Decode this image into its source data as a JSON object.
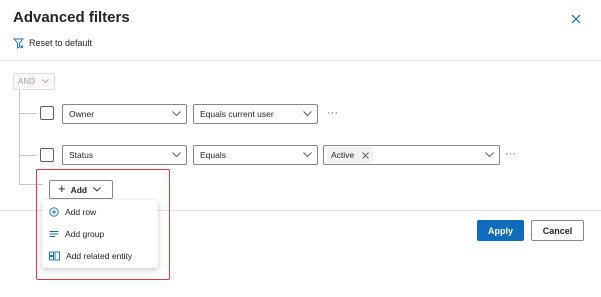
{
  "dialog": {
    "title": "Advanced filters",
    "reset_label": "Reset to default"
  },
  "group": {
    "operator": "AND"
  },
  "rows": [
    {
      "field": "Owner",
      "operator": "Equals current user",
      "more": "···"
    },
    {
      "field": "Status",
      "operator": "Equals",
      "value_tag": "Active",
      "more": "···"
    }
  ],
  "add": {
    "label": "Add",
    "menu": [
      {
        "label": "Add row",
        "icon": "plus-circle-icon"
      },
      {
        "label": "Add group",
        "icon": "group-lines-icon"
      },
      {
        "label": "Add related entity",
        "icon": "related-entity-icon"
      }
    ]
  },
  "footer": {
    "apply_label": "Apply",
    "cancel_label": "Cancel"
  },
  "colors": {
    "primary": "#0f6cbd",
    "highlight": "#e0393b",
    "icon_blue": "#0f6cbd"
  }
}
